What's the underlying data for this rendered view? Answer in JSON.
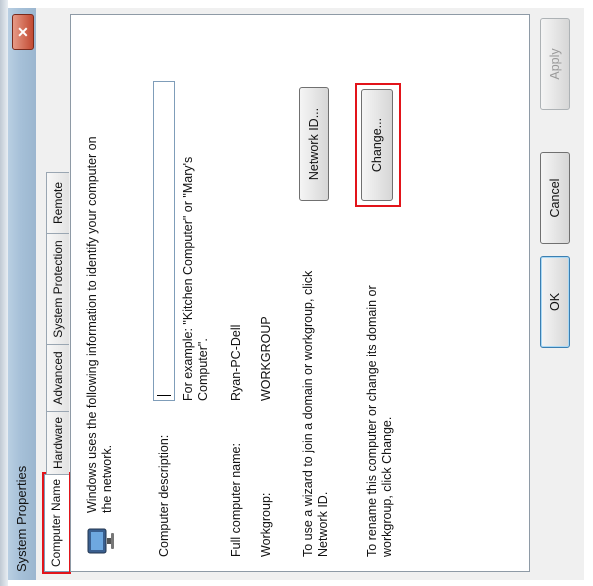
{
  "window": {
    "title": "System Properties",
    "close_glyph": "✕"
  },
  "tabs": [
    {
      "label": "Computer Name"
    },
    {
      "label": "Hardware"
    },
    {
      "label": "Advanced"
    },
    {
      "label": "System Protection"
    },
    {
      "label": "Remote"
    }
  ],
  "panel": {
    "intro": "Windows uses the following information to identify your computer on the network.",
    "description_label": "Computer description:",
    "description_value": "",
    "example": "For example: \"Kitchen Computer\" or \"Mary's Computer\".",
    "full_name_label": "Full computer name:",
    "full_name_value": "Ryan-PC-Dell",
    "workgroup_label": "Workgroup:",
    "workgroup_value": "WORKGROUP",
    "wizard_text": "To use a wizard to join a domain or workgroup, click Network ID.",
    "network_id_label": "Network ID...",
    "rename_text": "To rename this computer or change its domain or workgroup, click Change.",
    "change_label": "Change..."
  },
  "buttons": {
    "ok": "OK",
    "cancel": "Cancel",
    "apply": "Apply"
  },
  "colors": {
    "highlight": "#e2141a",
    "titlebar": "#a6c0d8"
  },
  "icons": {
    "computer": "computer-icon",
    "close": "close-icon"
  }
}
